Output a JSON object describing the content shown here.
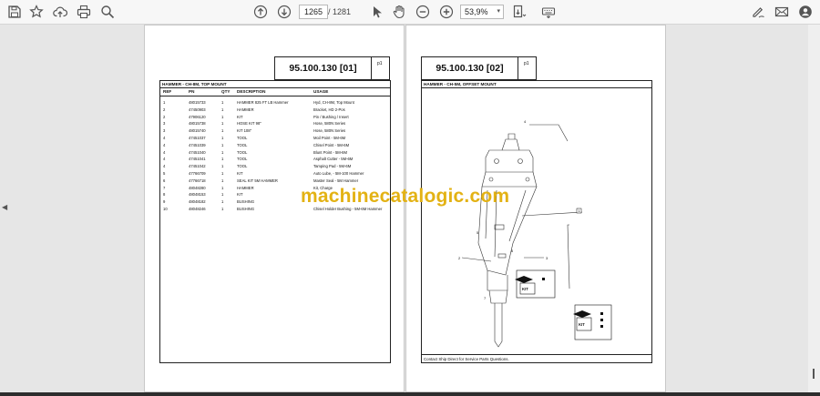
{
  "toolbar": {
    "page_current": "1265",
    "page_separator": "/",
    "page_total": "1281",
    "zoom": "53,9%",
    "icons_left": [
      "save-icon",
      "bookmark-star-icon",
      "upload-cloud-icon",
      "print-icon",
      "zoom-search-icon"
    ],
    "icons_center": [
      "previous-page-icon",
      "next-page-icon",
      "select-cursor-icon",
      "hand-tool-icon",
      "zoom-out-icon",
      "zoom-in-icon",
      "fit-page-icon",
      "keyboard-icon"
    ],
    "icons_right": [
      "sign-pen-icon",
      "email-icon",
      "account-icon"
    ]
  },
  "page_left": {
    "title": "95.100.130 [01]",
    "page_mark": "p1",
    "section": "HAMMER - CH-8M, TOP MOUNT",
    "headers": {
      "ref": "REF",
      "pn": "PN",
      "qty": "QTY",
      "desc": "DESCRIPTION",
      "usage": "USAGE"
    },
    "rows": [
      {
        "ref": "1",
        "pn": "48015733",
        "qty": "1",
        "desc": "HAMMER 825 FT LB Hammer",
        "usage": "Hyd, CH-8M, Top Mount"
      },
      {
        "ref": "2",
        "pn": "47450903",
        "qty": "1",
        "desc": "HAMMER",
        "usage": "Bracket, HD 2-Pos"
      },
      {
        "ref": "2",
        "pn": "47906120",
        "qty": "1",
        "desc": "KIT",
        "usage": "Pin / Bushing / Insert"
      },
      {
        "ref": "3",
        "pn": "48015738",
        "qty": "1",
        "desc": "HOSE KIT 98\"",
        "usage": "Hose, 580N Series"
      },
      {
        "ref": "3",
        "pn": "48015740",
        "qty": "1",
        "desc": "KIT 108\"",
        "usage": "Hose, 580N Series"
      },
      {
        "ref": "4",
        "pn": "47451037",
        "qty": "1",
        "desc": "TOOL",
        "usage": "Moil Point - 5M-6M"
      },
      {
        "ref": "4",
        "pn": "47451039",
        "qty": "1",
        "desc": "TOOL",
        "usage": "Chisel Point - 5M-6M"
      },
      {
        "ref": "4",
        "pn": "47451040",
        "qty": "1",
        "desc": "TOOL",
        "usage": "Blunt Point - 5M-6M"
      },
      {
        "ref": "4",
        "pn": "47451041",
        "qty": "1",
        "desc": "TOOL",
        "usage": "Asphalt Cutter - 5M-6M"
      },
      {
        "ref": "4",
        "pn": "47451042",
        "qty": "1",
        "desc": "TOOL",
        "usage": "Tamping Pad - 5M-6M"
      },
      {
        "ref": "5",
        "pn": "47766709",
        "qty": "1",
        "desc": "KIT",
        "usage": "Auto Lube, - 5M-100 Hammer"
      },
      {
        "ref": "6",
        "pn": "47766718",
        "qty": "1",
        "desc": "SEAL KIT 5M HAMMER",
        "usage": "Master Seal - 5M Hammer"
      },
      {
        "ref": "7",
        "pn": "48048280",
        "qty": "1",
        "desc": "HAMMER",
        "usage": "Kit, Charge"
      },
      {
        "ref": "8",
        "pn": "48048153",
        "qty": "1",
        "desc": "KIT",
        "usage": ""
      },
      {
        "ref": "9",
        "pn": "48048182",
        "qty": "1",
        "desc": "BUSHING",
        "usage": ""
      },
      {
        "ref": "10",
        "pn": "48048246",
        "qty": "1",
        "desc": "BUSHING",
        "usage": "Chisel Holder Bushing - 5M-6M Hammer"
      }
    ]
  },
  "page_right": {
    "title": "95.100.130 [02]",
    "page_mark": "p1",
    "section": "HAMMER - CH-5M, OFFSET MOUNT",
    "callouts": [
      "1",
      "2",
      "3",
      "4",
      "5",
      "6",
      "7"
    ],
    "kit_label": "KIT",
    "footer": "Contact Ship Direct for Service Parts Questions."
  },
  "watermark": "machinecatalogic.com"
}
